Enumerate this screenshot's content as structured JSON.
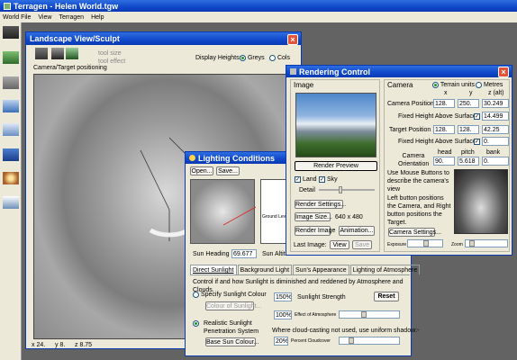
{
  "app": {
    "title": "Terragen - Helen World.tgw"
  },
  "menu": [
    "World File",
    "View",
    "Terragen",
    "Help"
  ],
  "landscape": {
    "title": "Landscape View/Sculpt",
    "tool_size": "tool size",
    "tool_effect": "tool effect",
    "tool_label": "Camera/Target positioning",
    "display_heights_label": "Display Heights:",
    "greys": "Greys",
    "cols": "Cols"
  },
  "status": {
    "x": "x 24.",
    "y": "y 8.",
    "z": "z 8.75"
  },
  "lighting": {
    "title": "Lighting Conditions",
    "open": "Open...",
    "save": "Save...",
    "sun_heading_label": "Sun Heading",
    "sun_heading": "69.677",
    "sun_alt_label": "Sun Altit",
    "ground_label": "Ground Leve",
    "tabs": [
      "Direct Sunlight",
      "Background Light",
      "Sun's Appearance",
      "Lighting of Atmosphere"
    ],
    "description": "Control if and how Sunlight is diminished and reddened by Atmosphere and Clouds.",
    "specify_colour": "Specify Sunlight Colour",
    "colour_btn": "Colour of Sunlight...",
    "strength_value": "150%",
    "strength_label": "Sunlight Strength",
    "reset": "Reset",
    "atm_value": "100%",
    "atm_label": "Effect of Atmosphere",
    "realistic": "Realistic Sunlight Penetration System",
    "cloud_note": "Where cloud-casting not used, use uniform shadow:-",
    "cloud_value": "20%",
    "cloud_label": "Percent Cloudcover",
    "base_colour": "Base Sun Colour..."
  },
  "render": {
    "title": "Rendering Control",
    "image_section": "Image",
    "camera_section": "Camera",
    "render_preview": "Render Preview",
    "land": "Land",
    "sky": "Sky",
    "detail": "Detail",
    "render_settings": "Render Settings...",
    "image_size_btn": "Image Size...",
    "image_size": "640 x 480",
    "render_image": "Render Image",
    "animation": "Animation...",
    "last_image": "Last Image:",
    "view": "View",
    "save": "Save",
    "terrain_units": "Terrain units",
    "metres": "Metres",
    "col_x": "x",
    "col_y": "y",
    "col_z": "z (alt)",
    "camera_position_label": "Camera Position",
    "camera_position": [
      "128.",
      "250.",
      "30.249"
    ],
    "fixed_height_label": "Fixed Height Above Surface",
    "camera_fixed": "14.499",
    "target_position_label": "Target Position",
    "target_position": [
      "128.",
      "128.",
      "42.25"
    ],
    "target_fixed": "0.",
    "col_head": "head",
    "col_pitch": "pitch",
    "col_bank": "bank",
    "orientation_label": "Camera Orientation",
    "orientation": [
      "90.",
      "5.618",
      "0."
    ],
    "mouse_help": "Use Mouse Buttons to describe the camera's view",
    "mouse_help2": "Left button positions the Camera, and Right button positions the Target.",
    "camera_settings": "Camera Settings...",
    "exposure": "Exposure",
    "zoom": "Zoom"
  },
  "colors": {
    "accent": "#0a3ab3",
    "titlebar": "#1048c9",
    "window": "#ece9d8"
  }
}
